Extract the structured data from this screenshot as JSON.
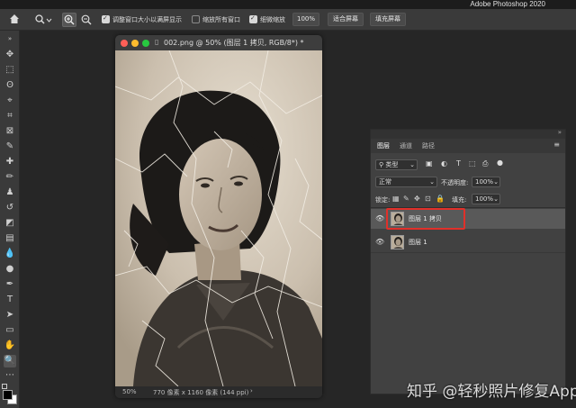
{
  "app": {
    "title": "Adobe Photoshop 2020"
  },
  "options": {
    "check_resize": "调整窗口大小以满屏显示",
    "check_zoom_all": "缩放所有窗口",
    "check_scrubby": "细微缩放",
    "zoom_value": "100%",
    "fit_screen": "适合屏幕",
    "fill_screen": "填充屏幕"
  },
  "document": {
    "title": "002.png @ 50% (图层 1 拷贝, RGB/8*) *",
    "status_zoom": "50%",
    "status_size": "770 像素 x 1160 像素 (144 ppi)"
  },
  "layers_panel": {
    "tabs": [
      "图层",
      "通道",
      "路径"
    ],
    "filter_kind": "类型",
    "blend_mode": "正常",
    "opacity_label": "不透明度:",
    "opacity_value": "100%",
    "lock_label": "锁定:",
    "fill_label": "填充:",
    "fill_value": "100%",
    "layers": [
      {
        "name": "图层 1 拷贝",
        "selected": true
      },
      {
        "name": "图层 1",
        "selected": false
      }
    ]
  },
  "watermark": "知乎 @轻秒照片修复App",
  "colors": {
    "highlight": "#e0302a",
    "selected_row": "#595959",
    "panel_bg": "#414141"
  }
}
